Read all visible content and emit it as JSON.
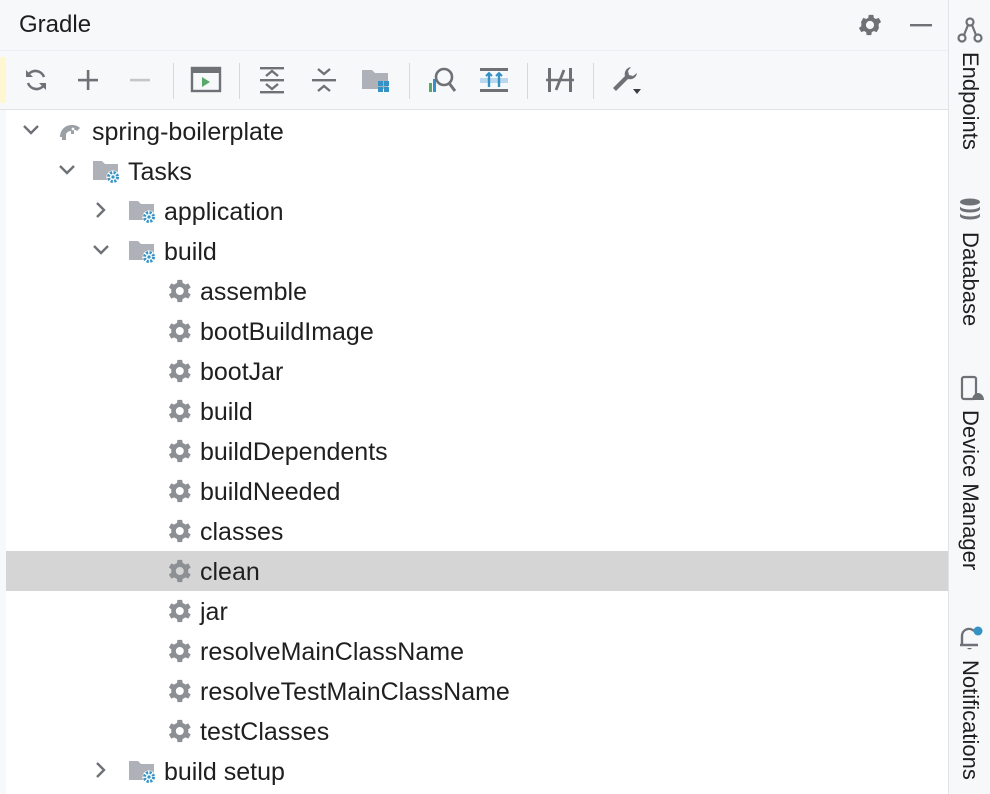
{
  "panel": {
    "title": "Gradle"
  },
  "toolbar": {
    "buttons": [
      {
        "name": "reload"
      },
      {
        "name": "add"
      },
      {
        "name": "remove"
      },
      {
        "name": "execute-task"
      },
      {
        "name": "expand-all"
      },
      {
        "name": "collapse-all"
      },
      {
        "name": "group-tasks"
      },
      {
        "name": "analyze-dependencies"
      },
      {
        "name": "show-dependencies"
      },
      {
        "name": "toggle-offline"
      },
      {
        "name": "build-tool-settings"
      }
    ]
  },
  "tree": {
    "project": "spring-boilerplate",
    "tasks_folder": "Tasks",
    "groups": [
      "application",
      "build",
      "build setup"
    ],
    "build_tasks": [
      "assemble",
      "bootBuildImage",
      "bootJar",
      "build",
      "buildDependents",
      "buildNeeded",
      "classes",
      "clean",
      "jar",
      "resolveMainClassName",
      "resolveTestMainClassName",
      "testClasses"
    ],
    "selected": "clean"
  },
  "sidebar": {
    "items": [
      {
        "label": "Endpoints",
        "icon": "endpoints-icon"
      },
      {
        "label": "Database",
        "icon": "database-icon"
      },
      {
        "label": "Device Manager",
        "icon": "device-manager-icon"
      },
      {
        "label": "Notifications",
        "icon": "bell-icon"
      }
    ]
  },
  "colors": {
    "accent": "#3592c4",
    "selected_row": "#d5d5d5",
    "icon_gray": "#8c8f94",
    "run_green": "#59a869"
  }
}
